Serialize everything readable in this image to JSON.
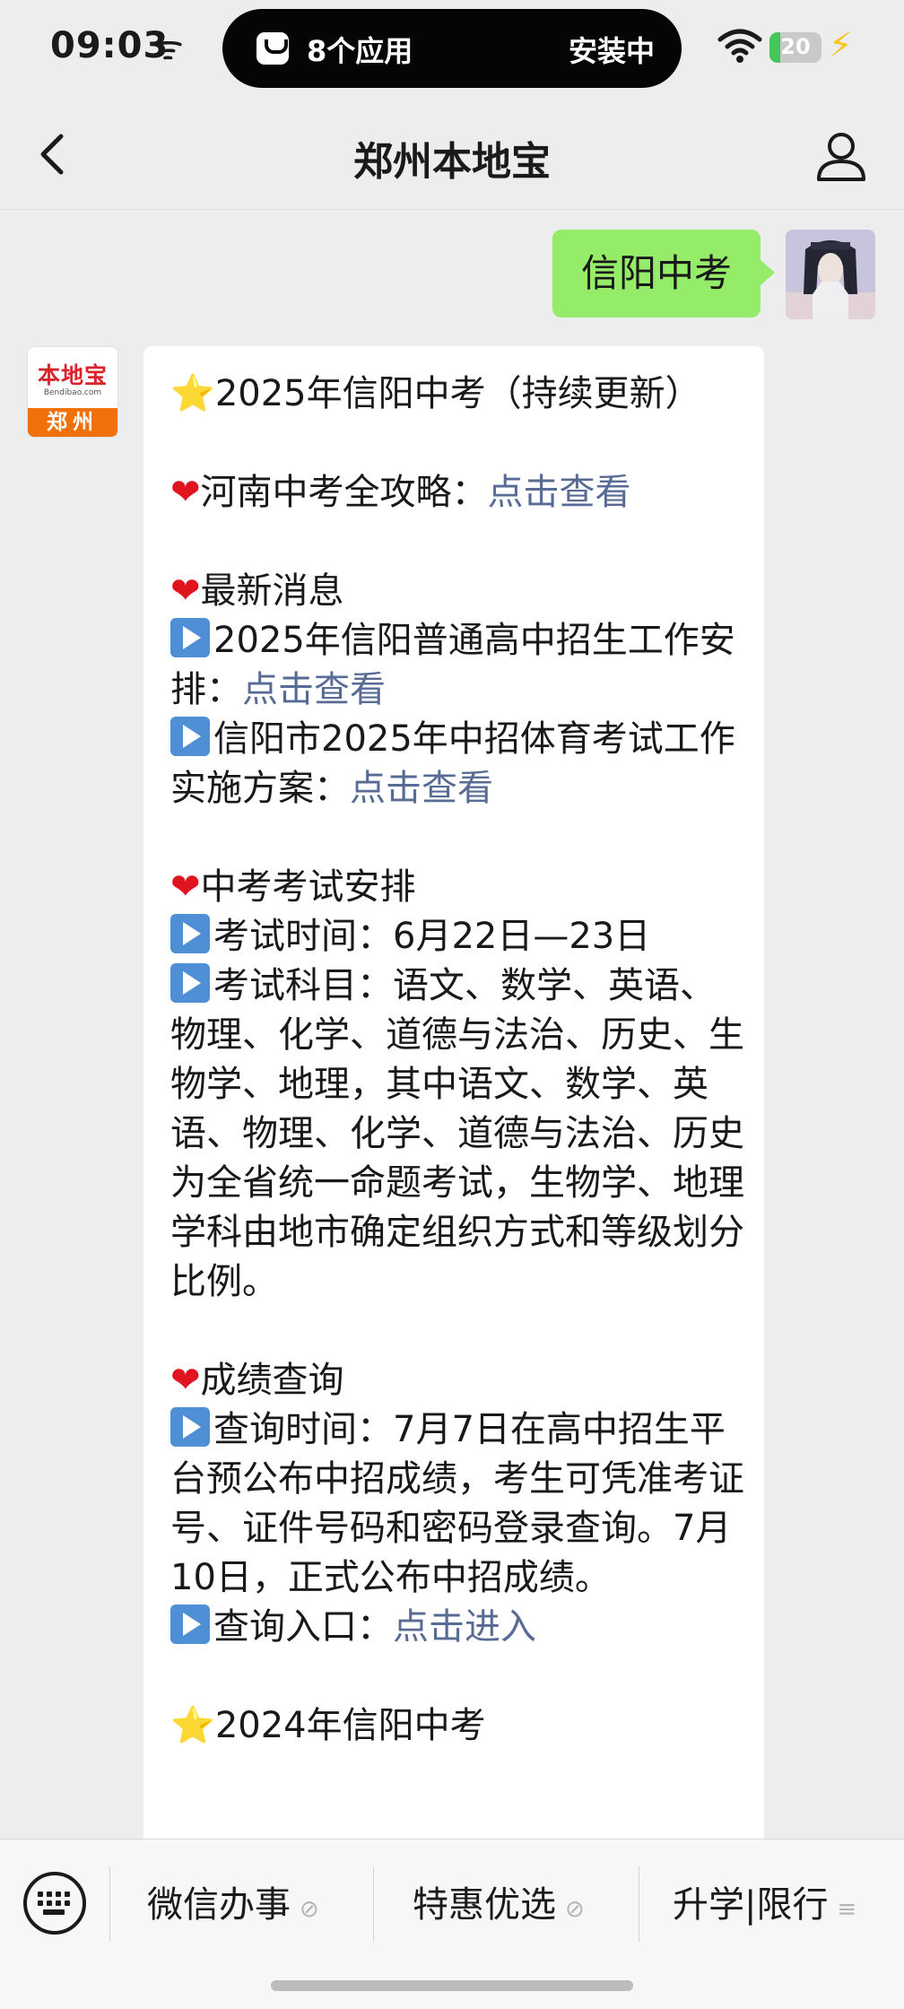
{
  "status_bar": {
    "time": "09:03",
    "live_activity": {
      "apps": "8个应用",
      "status": "安装中"
    },
    "battery_level": "20"
  },
  "nav": {
    "title": "郑州本地宝"
  },
  "bot_avatar": {
    "logo_top": "本地宝",
    "logo_url": "Bendibao.com",
    "logo_bottom": "郑州"
  },
  "chat": {
    "user_message": "信阳中考",
    "bot_message": {
      "title": "2025年信阳中考（持续更新）",
      "strategy_label": "河南中考全攻略：",
      "strategy_link": "点击查看",
      "news_heading": "最新消息",
      "news_1_text": "2025年信阳普通高中招生工作安排：",
      "news_1_link": "点击查看",
      "news_2_text": "信阳市2025年中招体育考试工作实施方案：",
      "news_2_link": "点击查看",
      "exam_heading": "中考考试安排",
      "exam_time": "考试时间：6月22日—23日",
      "exam_subjects": "考试科目：语文、数学、英语、物理、化学、道德与法治、历史、生物学、地理，其中语文、数学、英语、物理、化学、道德与法治、历史为全省统一命题考试，生物学、地理学科由地市确定组织方式和等级划分比例。",
      "score_heading": "成绩查询",
      "score_time": "查询时间：7月7日在高中招生平台预公布中招成绩，考生可凭准考证号、证件号码和密码登录查询。7月10日，正式公布中招成绩。",
      "score_entry_label": "查询入口：",
      "score_entry_link": "点击进入",
      "prev_year_title": "2024年信阳中考"
    }
  },
  "menu": {
    "items": [
      {
        "label": "微信办事",
        "icon": "link-icon"
      },
      {
        "label": "特惠优选",
        "icon": "link-icon"
      },
      {
        "label": "升学|限行",
        "icon": "submenu-icon"
      }
    ]
  }
}
